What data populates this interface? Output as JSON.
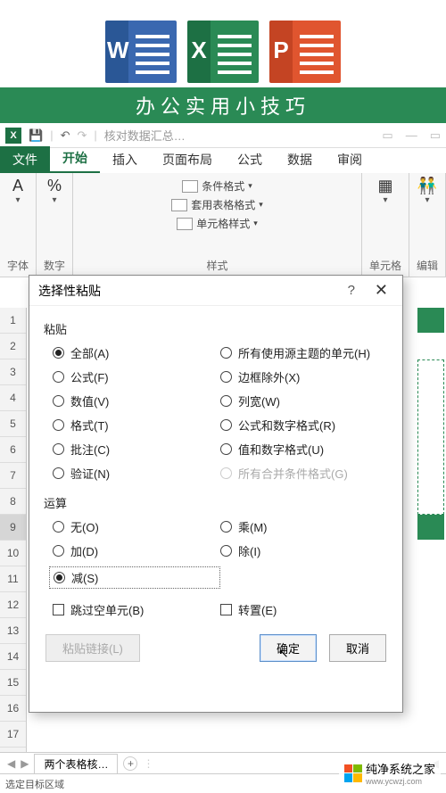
{
  "header_title": "办公实用小技巧",
  "qat": {
    "doc_title": "核对数据汇总…"
  },
  "tabs": {
    "file": "文件",
    "home": "开始",
    "insert": "插入",
    "pagelayout": "页面布局",
    "formulas": "公式",
    "data": "数据",
    "review": "审阅"
  },
  "ribbon": {
    "font": {
      "icon": "A",
      "label": "字体"
    },
    "number": {
      "icon": "%",
      "label": "数字"
    },
    "styles": {
      "cond": "条件格式",
      "table": "套用表格格式",
      "cell": "单元格样式",
      "label": "样式"
    },
    "cells": {
      "label": "单元格"
    },
    "editing": {
      "icon": "👬",
      "label": "编辑"
    }
  },
  "dialog": {
    "title": "选择性粘贴",
    "section_paste": "粘贴",
    "paste_options": {
      "all": "全部(A)",
      "formulas": "公式(F)",
      "values": "数值(V)",
      "formats": "格式(T)",
      "comments": "批注(C)",
      "validation": "验证(N)",
      "all_theme": "所有使用源主题的单元(H)",
      "except_borders": "边框除外(X)",
      "col_widths": "列宽(W)",
      "formulas_num": "公式和数字格式(R)",
      "values_num": "值和数字格式(U)",
      "all_cond": "所有合并条件格式(G)"
    },
    "section_op": "运算",
    "op_options": {
      "none": "无(O)",
      "add": "加(D)",
      "subtract": "减(S)",
      "multiply": "乘(M)",
      "divide": "除(I)"
    },
    "skip_blanks": "跳过空单元(B)",
    "transpose": "转置(E)",
    "paste_link": "粘贴链接(L)",
    "ok": "确定",
    "cancel": "取消"
  },
  "rows": [
    "1",
    "2",
    "3",
    "4",
    "5",
    "6",
    "7",
    "8",
    "9",
    "10",
    "11",
    "12",
    "13",
    "14",
    "15",
    "16",
    "17"
  ],
  "sheet_tab": "两个表格核…",
  "status_text": "选定目标区域",
  "watermark": "纯净系统之家",
  "watermark_url": "www.ycwzj.com"
}
